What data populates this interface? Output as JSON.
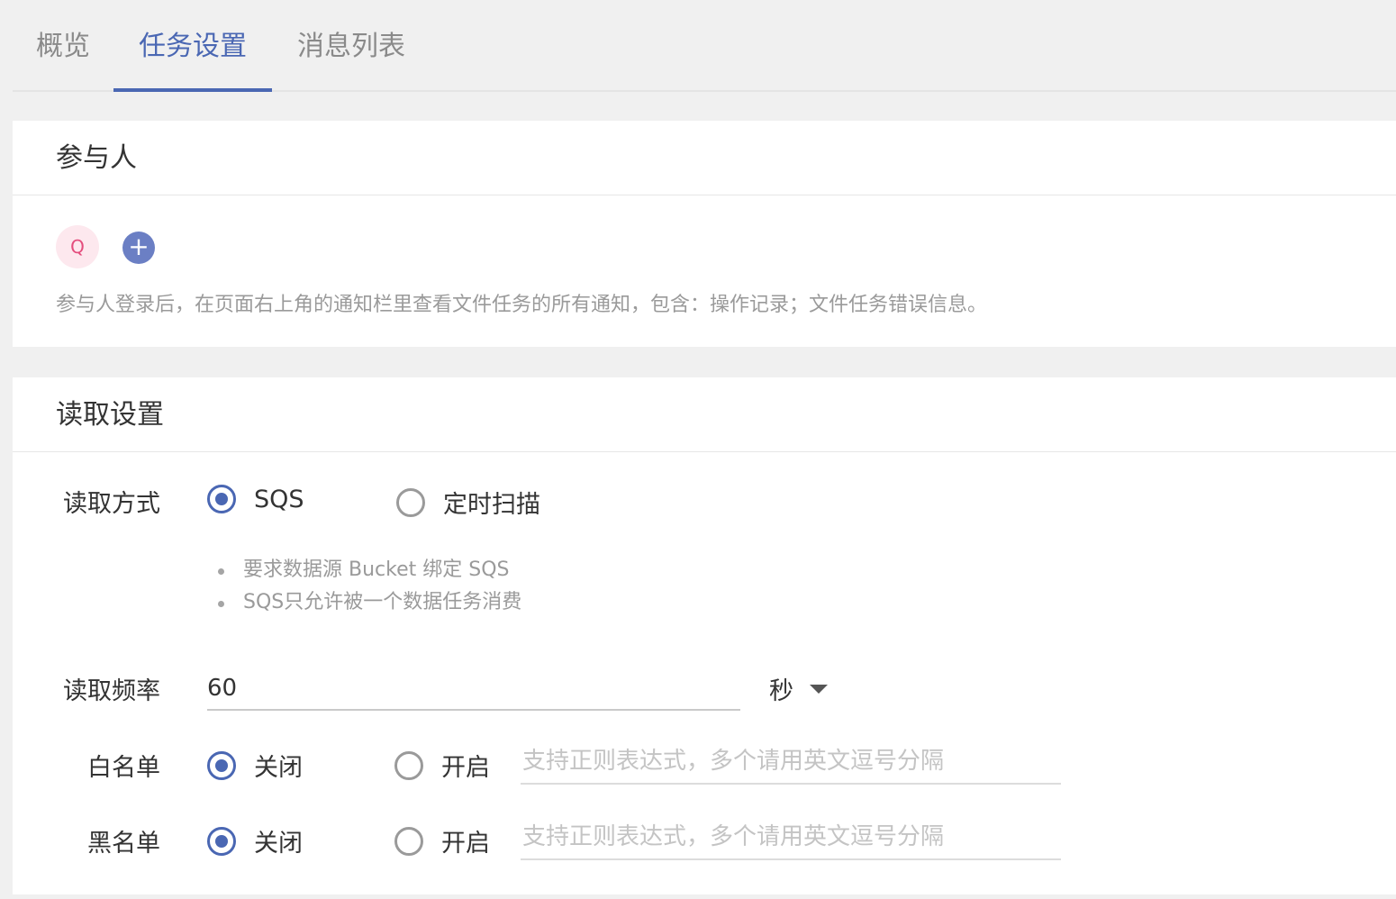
{
  "tabs": [
    {
      "label": "概览"
    },
    {
      "label": "任务设置"
    },
    {
      "label": "消息列表"
    }
  ],
  "active_tab": "任务设置",
  "participants": {
    "title": "参与人",
    "avatar_initial": "Q",
    "add_symbol": "+",
    "hint": "参与人登录后，在页面右上角的通知栏里查看文件任务的所有通知，包含：操作记录；文件任务错误信息。"
  },
  "read_settings": {
    "title": "读取设置",
    "read_mode": {
      "label": "读取方式",
      "options": [
        {
          "label": "SQS",
          "selected": true
        },
        {
          "label": "定时扫描",
          "selected": false
        }
      ],
      "notes": [
        "要求数据源 Bucket 绑定 SQS",
        "SQS只允许被一个数据任务消费"
      ]
    },
    "frequency": {
      "label": "读取频率",
      "value": "60",
      "unit": "秒"
    },
    "whitelist": {
      "label": "白名单",
      "off_label": "关闭",
      "on_label": "开启",
      "selected": "关闭",
      "placeholder": "支持正则表达式，多个请用英文逗号分隔"
    },
    "blacklist": {
      "label": "黑名单",
      "off_label": "关闭",
      "on_label": "开启",
      "selected": "关闭",
      "placeholder": "支持正则表达式，多个请用英文逗号分隔"
    }
  },
  "colors": {
    "accent": "#4a67b3",
    "avatar_bg": "#fde8ee",
    "avatar_text": "#e44d7d",
    "add_button": "#6b7fc4"
  }
}
